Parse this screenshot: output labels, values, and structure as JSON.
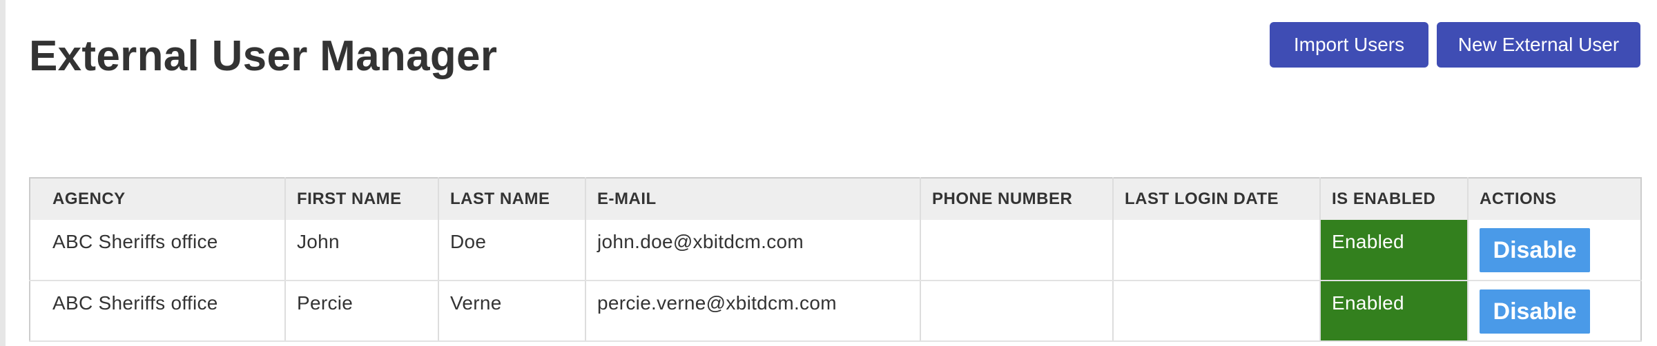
{
  "header": {
    "title": "External User Manager",
    "import_button": "Import Users",
    "new_user_button": "New External User"
  },
  "table": {
    "columns": [
      "AGENCY",
      "FIRST NAME",
      "LAST NAME",
      "E-MAIL",
      "PHONE NUMBER",
      "LAST LOGIN DATE",
      "IS ENABLED",
      "ACTIONS"
    ],
    "rows": [
      {
        "agency": "ABC Sheriffs office",
        "first_name": "John",
        "last_name": "Doe",
        "email": "john.doe@xbitdcm.com",
        "phone": "",
        "last_login": "",
        "status": "Enabled",
        "action": "Disable"
      },
      {
        "agency": "ABC Sheriffs office",
        "first_name": "Percie",
        "last_name": "Verne",
        "email": "percie.verne@xbitdcm.com",
        "phone": "",
        "last_login": "",
        "status": "Enabled",
        "action": "Disable"
      }
    ]
  },
  "colors": {
    "primary_button": "#3f4db4",
    "enabled_status": "#33801e",
    "disable_button": "#4a9ae8"
  }
}
